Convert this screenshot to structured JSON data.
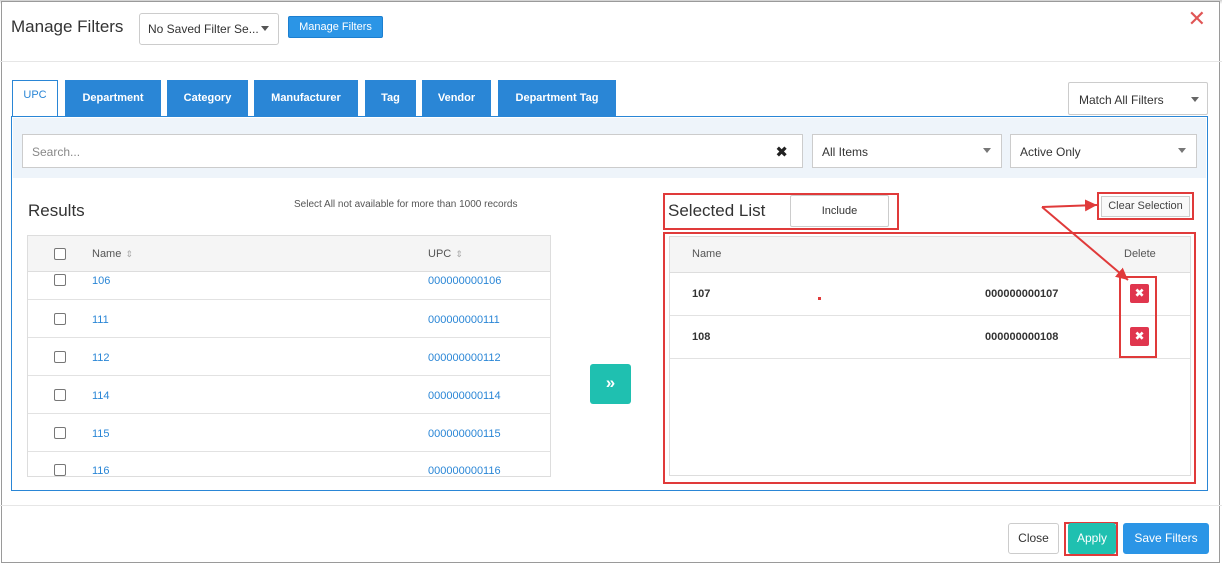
{
  "header": {
    "title": "Manage Filters",
    "saved_filter_select": "No Saved Filter Se...",
    "manage_filters_button": "Manage Filters",
    "close_glyph": "✕"
  },
  "tabs": [
    "UPC",
    "Department",
    "Category",
    "Manufacturer",
    "Tag",
    "Vendor",
    "Department Tag"
  ],
  "active_tab": "UPC",
  "match_select": "Match All Filters",
  "search": {
    "placeholder": "Search...",
    "clear_glyph": "✖"
  },
  "items_filter": "All Items",
  "status_filter": "Active Only",
  "results": {
    "title": "Results",
    "note": "Select All not available for more than 1000 records",
    "columns": {
      "name": "Name",
      "upc": "UPC",
      "sort_glyph": "⇕"
    },
    "rows": [
      {
        "name": "106",
        "upc": "000000000106"
      },
      {
        "name": "111",
        "upc": "000000000111"
      },
      {
        "name": "112",
        "upc": "000000000112"
      },
      {
        "name": "114",
        "upc": "000000000114"
      },
      {
        "name": "115",
        "upc": "000000000115"
      },
      {
        "name": "116",
        "upc": "000000000116"
      }
    ]
  },
  "move_button_glyph": "»",
  "selected_list": {
    "title": "Selected List",
    "include_button": "Include",
    "clear_selection": "Clear Selection",
    "columns": {
      "name": "Name",
      "delete": "Delete"
    },
    "rows": [
      {
        "name": "107",
        "upc": "000000000107"
      },
      {
        "name": "108",
        "upc": "000000000108"
      }
    ],
    "delete_glyph": "✖"
  },
  "footer": {
    "close_button": "Close",
    "apply_button": "Apply",
    "save_filters_button": "Save Filters"
  },
  "colors": {
    "primary_blue": "#2a86d6",
    "teal": "#1fc0b0",
    "delete_red": "#e0364e",
    "annotation_red": "#e03a3a"
  }
}
